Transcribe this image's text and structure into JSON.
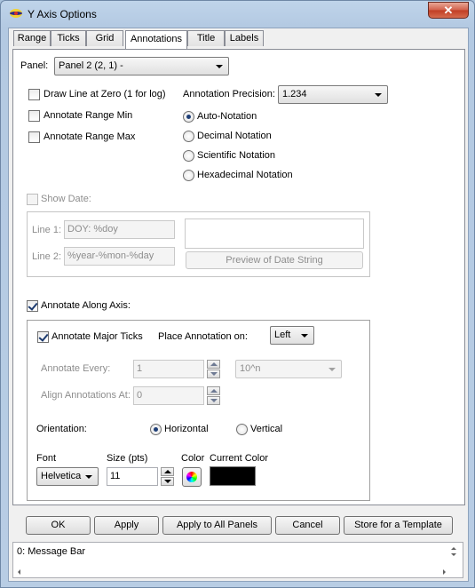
{
  "window": {
    "title": "Y Axis Options",
    "close_glyph": "✕"
  },
  "tabs": [
    "Range",
    "Ticks",
    "Grid",
    "Annotations",
    "Title",
    "Labels"
  ],
  "panel": {
    "label": "Panel:",
    "value": "Panel 2 (2, 1)  -"
  },
  "checkboxes": {
    "draw_line_at_zero": "Draw Line at Zero (1 for log)",
    "annotate_range_min": "Annotate Range Min",
    "annotate_range_max": "Annotate Range Max"
  },
  "precision": {
    "label": "Annotation Precision:",
    "value": "1.234"
  },
  "notation": [
    "Auto-Notation",
    "Decimal Notation",
    "Scientific Notation",
    "Hexadecimal Notation"
  ],
  "show_date": {
    "label": "Show Date:",
    "line1_label": "Line 1:",
    "line1_value": "DOY: %doy",
    "line2_label": "Line 2:",
    "line2_value": "%year-%mon-%day",
    "preview_button": "Preview of Date String"
  },
  "annotate_along_axis": {
    "label": "Annotate Along Axis:",
    "major_ticks_label": "Annotate Major Ticks",
    "place_label": "Place Annotation on:",
    "place_value": "Left",
    "every_label": "Annotate Every:",
    "every_value": "1",
    "every_unit": "10^n",
    "align_label": "Align Annotations At:",
    "align_value": "0",
    "orientation_label": "Orientation:",
    "orientation_options": [
      "Horizontal",
      "Vertical"
    ],
    "font_label": "Font",
    "font_value": "Helvetica",
    "size_label": "Size (pts)",
    "size_value": "11",
    "color_label": "Color",
    "current_color_label": "Current Color",
    "current_color": "#000000"
  },
  "buttons": [
    "OK",
    "Apply",
    "Apply to All Panels",
    "Cancel",
    "Store for a Template"
  ],
  "status": {
    "message": "0: Message Bar"
  }
}
